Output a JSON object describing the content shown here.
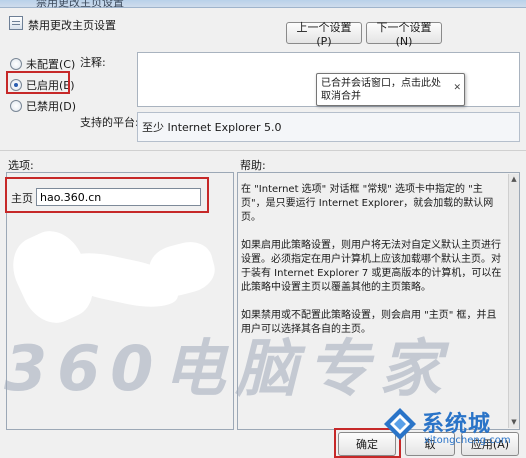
{
  "window": {
    "title": "禁用更改主页设置"
  },
  "header": {
    "title": "禁用更改主页设置"
  },
  "nav": {
    "prev_label": "上一个设置(P)",
    "next_label": "下一个设置(N)"
  },
  "options": [
    {
      "label": "未配置(C)",
      "selected": false
    },
    {
      "label": "已启用(E)",
      "selected": true
    },
    {
      "label": "已禁用(D)",
      "selected": false
    }
  ],
  "comment": {
    "label": "注释:"
  },
  "tooltip": {
    "text": "已合并会话窗口，点击此处取消合并"
  },
  "platform": {
    "label": "支持的平台:",
    "value": "至少 Internet Explorer 5.0"
  },
  "sections": {
    "options_label": "选项:",
    "help_label": "帮助:"
  },
  "homepage": {
    "label": "主页",
    "value": "hao.360.cn"
  },
  "help": {
    "p1": "在 \"Internet 选项\" 对话框 \"常规\" 选项卡中指定的 \"主页\"，是只要运行 Internet Explorer，就会加载的默认网页。",
    "p2": "如果启用此策略设置，则用户将无法对自定义默认主页进行设置。必须指定在用户计算机上应该加载哪个默认主页。对于装有 Internet Explorer 7 或更高版本的计算机，可以在此策略中设置主页以覆盖其他的主页策略。",
    "p3": "如果禁用或不配置此策略设置，则会启用 \"主页\" 框，并且用户可以选择其各自的主页。"
  },
  "footer": {
    "ok_label": "确定",
    "cancel_label": "取",
    "apply_label": "应用(A)"
  },
  "watermark": {
    "text": "360电脑专家"
  },
  "logo": {
    "text": "系统城",
    "url": "xitongcheng.com"
  },
  "colors": {
    "highlight": "#c62828",
    "logo_blue": "#2a74c8"
  }
}
